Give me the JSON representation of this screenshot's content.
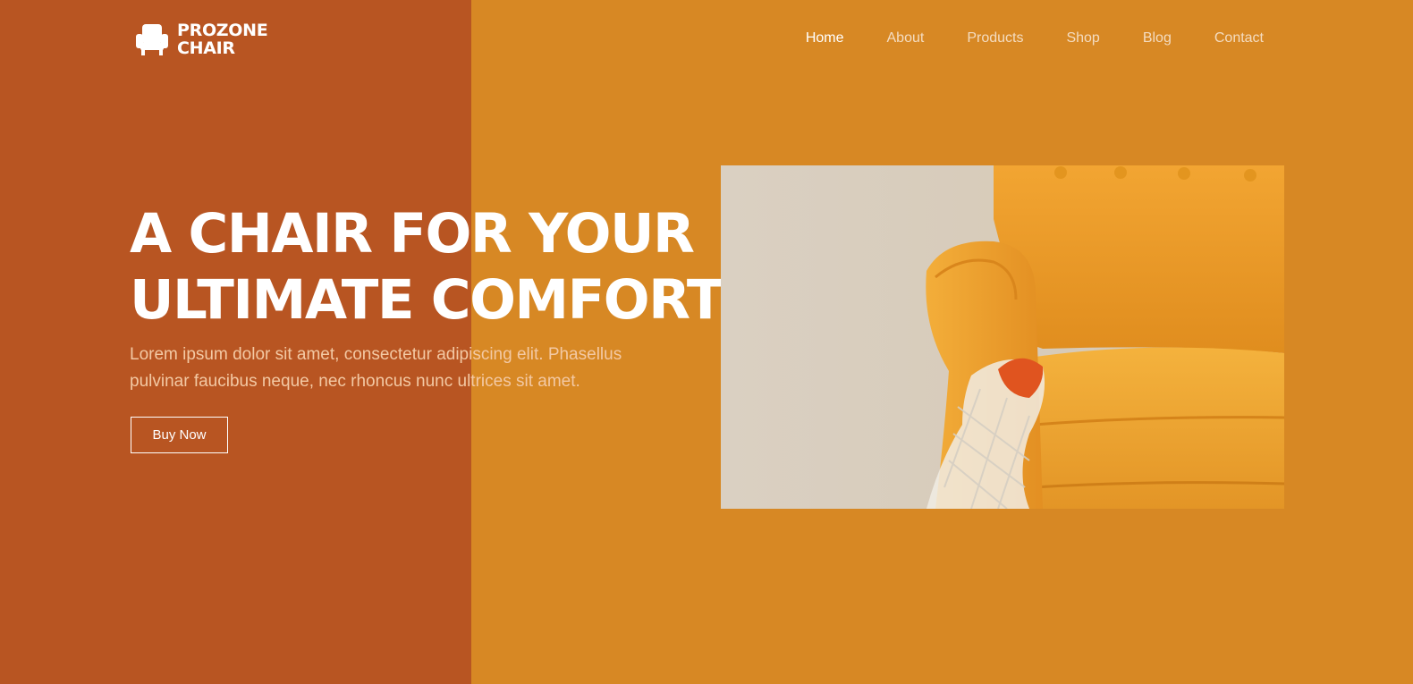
{
  "brand": {
    "line1": "PROZONE",
    "line2": "CHAIR",
    "icon": "armchair-icon"
  },
  "nav": {
    "items": [
      {
        "label": "Home",
        "active": true
      },
      {
        "label": "About",
        "active": false
      },
      {
        "label": "Products",
        "active": false
      },
      {
        "label": "Shop",
        "active": false
      },
      {
        "label": "Blog",
        "active": false
      },
      {
        "label": "Contact",
        "active": false
      }
    ]
  },
  "hero": {
    "title_line1": "A CHAIR FOR YOUR",
    "title_line2": "ULTIMATE COMFORT",
    "description": "Lorem ipsum dolor sit amet, consectetur adipiscing elit. Phasellus pulvinar faucibus neque, nec rhoncus nunc ultrices sit amet.",
    "button_label": "Buy Now"
  },
  "colors": {
    "left_panel": "#b85522",
    "background": "#d78824",
    "text": "#ffffff"
  }
}
